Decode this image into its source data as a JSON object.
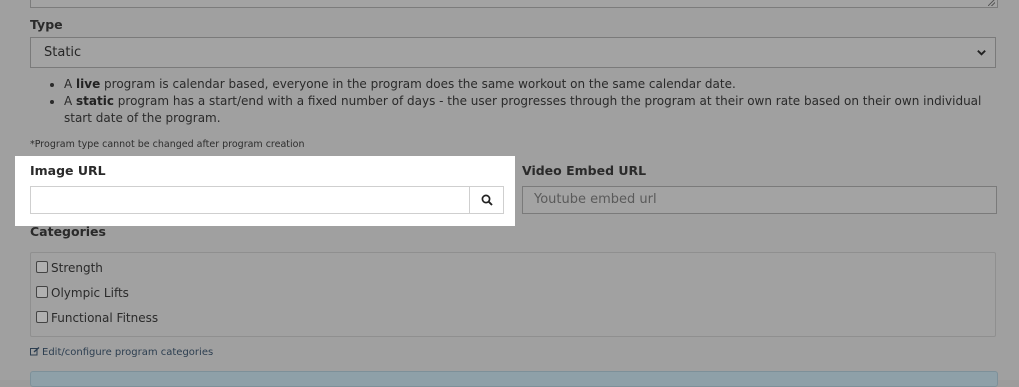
{
  "type_field": {
    "label": "Type",
    "selected": "Static"
  },
  "notes": {
    "live_prefix": "A ",
    "live_word": "live",
    "live_rest": " program is calendar based, everyone in the program does the same workout on the same calendar date.",
    "static_prefix": "A ",
    "static_word": "static",
    "static_rest": " program has a start/end with a fixed number of days - the user progresses through the program at their own rate based on their own individual start date of the program."
  },
  "type_note": "*Program type cannot be changed after program creation",
  "image_url": {
    "label": "Image URL",
    "value": "",
    "button_icon": "search-icon"
  },
  "video_embed": {
    "label": "Video Embed URL",
    "placeholder": "Youtube embed url"
  },
  "categories": {
    "label": "Categories",
    "items": [
      {
        "label": "Strength",
        "checked": false
      },
      {
        "label": "Olympic Lifts",
        "checked": false
      },
      {
        "label": "Functional Fitness",
        "checked": false
      }
    ],
    "edit_link": "Edit/configure program categories",
    "edit_icon": "edit-icon"
  }
}
